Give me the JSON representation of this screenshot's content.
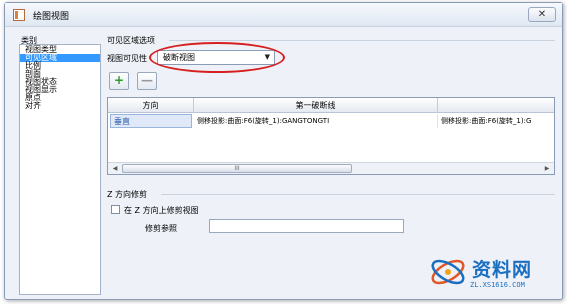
{
  "window": {
    "title": "绘图视图",
    "close_label": "✕"
  },
  "category": {
    "label": "类别",
    "items": [
      {
        "label": "视图类型",
        "selected": false
      },
      {
        "label": "可见区域",
        "selected": true
      },
      {
        "label": "比例",
        "selected": false
      },
      {
        "label": "剖面",
        "selected": false
      },
      {
        "label": "视图状态",
        "selected": false
      },
      {
        "label": "视图显示",
        "selected": false
      },
      {
        "label": "原点",
        "selected": false
      },
      {
        "label": "对齐",
        "selected": false
      }
    ]
  },
  "visible_area": {
    "group_title": "可见区域选项",
    "visibility_label": "视图可见性",
    "visibility_value": "破断视图",
    "highlight_color": "#d61f1f"
  },
  "toolbar": {
    "add_label": "+",
    "remove_label": "—"
  },
  "break_table": {
    "columns": [
      "方向",
      "第一破断线",
      "第二"
    ],
    "rows": [
      {
        "direction": "垂直",
        "first": "侧移投影:曲面:F6(旋转_1):GANGTONGTI",
        "second": "侧移投影:曲面:F6(旋转_1):G"
      }
    ],
    "scroll_thumb_label": "III"
  },
  "z_clip": {
    "group_title": "Z 方向修剪",
    "checkbox_label": "在 Z 方向上修剪视图",
    "checked": false,
    "trim_reference_label": "修剪参照",
    "trim_reference_value": ""
  },
  "watermark": {
    "brand": "资料网",
    "url": "ZL.XS1616.COM"
  },
  "colors": {
    "selection": "#3399ff",
    "add_icon": "#2e9a2e",
    "watermark": "#1a6fc1"
  }
}
